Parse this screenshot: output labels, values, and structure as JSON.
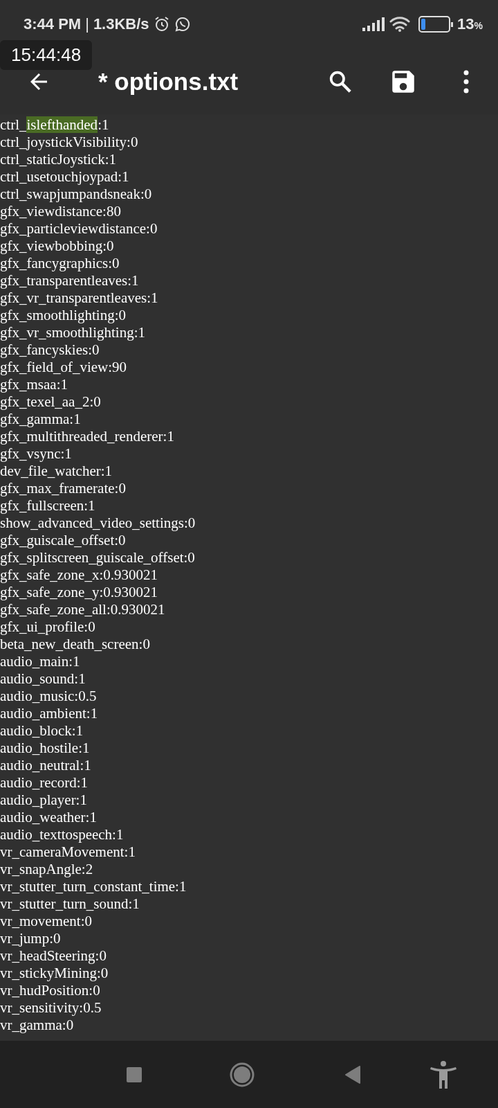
{
  "status_bar": {
    "time": "3:44 PM",
    "separator": "|",
    "speed": "1.3KB/s",
    "battery_text": "13",
    "battery_unit": "%"
  },
  "toast": {
    "text": "15:44:48"
  },
  "toolbar": {
    "title": "* options.txt"
  },
  "lines": [
    [
      {
        "text": "ctrl_",
        "highlighted": false
      },
      {
        "text": "islefthanded",
        "highlighted": true
      },
      {
        "text": ":1",
        "highlighted": false
      }
    ],
    [
      {
        "text": "ctrl_joystickVisibility:0",
        "highlighted": false
      }
    ],
    [
      {
        "text": "ctrl_staticJoystick:1",
        "highlighted": false
      }
    ],
    [
      {
        "text": "ctrl_usetouchjoypad:1",
        "highlighted": false
      }
    ],
    [
      {
        "text": "ctrl_swapjumpandsneak:0",
        "highlighted": false
      }
    ],
    [
      {
        "text": "gfx_viewdistance:80",
        "highlighted": false
      }
    ],
    [
      {
        "text": "gfx_particleviewdistance:0",
        "highlighted": false
      }
    ],
    [
      {
        "text": "gfx_viewbobbing:0",
        "highlighted": false
      }
    ],
    [
      {
        "text": "gfx_fancygraphics:0",
        "highlighted": false
      }
    ],
    [
      {
        "text": "gfx_transparentleaves:1",
        "highlighted": false
      }
    ],
    [
      {
        "text": "gfx_vr_transparentleaves:1",
        "highlighted": false
      }
    ],
    [
      {
        "text": "gfx_smoothlighting:0",
        "highlighted": false
      }
    ],
    [
      {
        "text": "gfx_vr_smoothlighting:1",
        "highlighted": false
      }
    ],
    [
      {
        "text": "gfx_fancyskies:0",
        "highlighted": false
      }
    ],
    [
      {
        "text": "gfx_field_of_view:90",
        "highlighted": false
      }
    ],
    [
      {
        "text": "gfx_msaa:1",
        "highlighted": false
      }
    ],
    [
      {
        "text": "gfx_texel_aa_2:0",
        "highlighted": false
      }
    ],
    [
      {
        "text": "gfx_gamma:1",
        "highlighted": false
      }
    ],
    [
      {
        "text": "gfx_multithreaded_renderer:1",
        "highlighted": false
      }
    ],
    [
      {
        "text": "gfx_vsync:1",
        "highlighted": false
      }
    ],
    [
      {
        "text": "dev_file_watcher:1",
        "highlighted": false
      }
    ],
    [
      {
        "text": "gfx_max_framerate:0",
        "highlighted": false
      }
    ],
    [
      {
        "text": "gfx_fullscreen:1",
        "highlighted": false
      }
    ],
    [
      {
        "text": "show_advanced_video_settings:0",
        "highlighted": false
      }
    ],
    [
      {
        "text": "gfx_guiscale_offset:0",
        "highlighted": false
      }
    ],
    [
      {
        "text": "gfx_splitscreen_guiscale_offset:0",
        "highlighted": false
      }
    ],
    [
      {
        "text": "gfx_safe_zone_x:0.930021",
        "highlighted": false
      }
    ],
    [
      {
        "text": "gfx_safe_zone_y:0.930021",
        "highlighted": false
      }
    ],
    [
      {
        "text": "gfx_safe_zone_all:0.930021",
        "highlighted": false
      }
    ],
    [
      {
        "text": "gfx_ui_profile:0",
        "highlighted": false
      }
    ],
    [
      {
        "text": "beta_new_death_screen:0",
        "highlighted": false
      }
    ],
    [
      {
        "text": "audio_main:1",
        "highlighted": false
      }
    ],
    [
      {
        "text": "audio_sound:1",
        "highlighted": false
      }
    ],
    [
      {
        "text": "audio_music:0.5",
        "highlighted": false
      }
    ],
    [
      {
        "text": "audio_ambient:1",
        "highlighted": false
      }
    ],
    [
      {
        "text": "audio_block:1",
        "highlighted": false
      }
    ],
    [
      {
        "text": "audio_hostile:1",
        "highlighted": false
      }
    ],
    [
      {
        "text": "audio_neutral:1",
        "highlighted": false
      }
    ],
    [
      {
        "text": "audio_record:1",
        "highlighted": false
      }
    ],
    [
      {
        "text": "audio_player:1",
        "highlighted": false
      }
    ],
    [
      {
        "text": "audio_weather:1",
        "highlighted": false
      }
    ],
    [
      {
        "text": "audio_texttospeech:1",
        "highlighted": false
      }
    ],
    [
      {
        "text": "vr_cameraMovement:1",
        "highlighted": false
      }
    ],
    [
      {
        "text": "vr_snapAngle:2",
        "highlighted": false
      }
    ],
    [
      {
        "text": "vr_stutter_turn_constant_time:1",
        "highlighted": false
      }
    ],
    [
      {
        "text": "vr_stutter_turn_sound:1",
        "highlighted": false
      }
    ],
    [
      {
        "text": "vr_movement:0",
        "highlighted": false
      }
    ],
    [
      {
        "text": "vr_jump:0",
        "highlighted": false
      }
    ],
    [
      {
        "text": "vr_headSteering:0",
        "highlighted": false
      }
    ],
    [
      {
        "text": "vr_stickyMining:0",
        "highlighted": false
      }
    ],
    [
      {
        "text": "vr_hudPosition:0",
        "highlighted": false
      }
    ],
    [
      {
        "text": "vr_sensitivity:0.5",
        "highlighted": false
      }
    ],
    [
      {
        "text": "vr_gamma:0",
        "highlighted": false
      }
    ]
  ]
}
